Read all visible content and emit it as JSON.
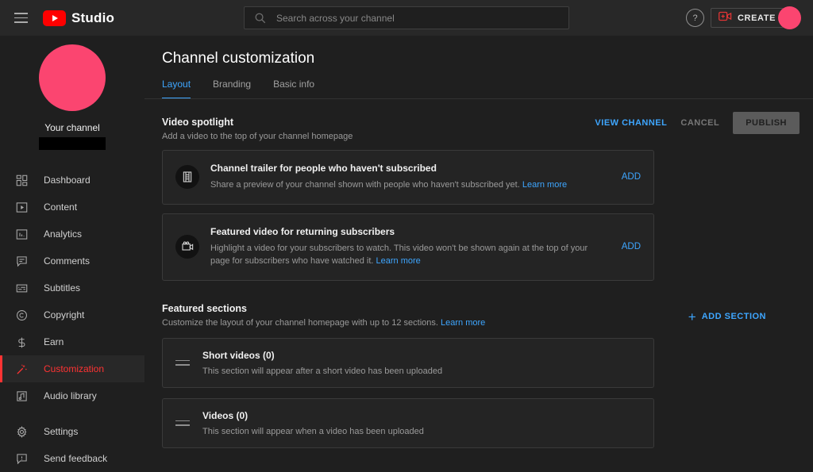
{
  "topbar": {
    "menu_icon": "hamburger-icon",
    "logo_text": "Studio",
    "search": {
      "placeholder": "Search across your channel",
      "value": "",
      "icon": "search-icon"
    },
    "help_icon": "?",
    "create_label": "CREATE",
    "create_icon": "video-camera-plus-icon",
    "avatar": "account-avatar"
  },
  "sidebar": {
    "channel": {
      "name": "Your channel",
      "handle_redacted": ""
    },
    "items": [
      {
        "label": "Dashboard",
        "icon": "dashboard-grid-icon",
        "active": false
      },
      {
        "label": "Content",
        "icon": "content-play-box-icon",
        "active": false
      },
      {
        "label": "Analytics",
        "icon": "analytics-bar-chart-icon",
        "active": false
      },
      {
        "label": "Comments",
        "icon": "comments-bubble-icon",
        "active": false
      },
      {
        "label": "Subtitles",
        "icon": "subtitles-cc-icon",
        "active": false
      },
      {
        "label": "Copyright",
        "icon": "copyright-circle-icon",
        "active": false
      },
      {
        "label": "Earn",
        "icon": "earn-dollar-icon",
        "active": false
      },
      {
        "label": "Customization",
        "icon": "magic-wand-icon",
        "active": true
      },
      {
        "label": "Audio library",
        "icon": "audio-note-icon",
        "active": false
      }
    ],
    "footer_items": [
      {
        "label": "Settings",
        "icon": "gear-icon"
      },
      {
        "label": "Send feedback",
        "icon": "feedback-icon"
      }
    ]
  },
  "main": {
    "title": "Channel customization",
    "tabs": [
      {
        "label": "Layout",
        "active": true
      },
      {
        "label": "Branding",
        "active": false
      },
      {
        "label": "Basic info",
        "active": false
      }
    ],
    "actions": {
      "view_channel": "VIEW CHANNEL",
      "cancel": "CANCEL",
      "publish": "PUBLISH"
    },
    "video_spotlight": {
      "title": "Video spotlight",
      "subtitle": "Add a video to the top of your channel homepage",
      "cards": [
        {
          "icon": "film-strip-icon",
          "title": "Channel trailer for people who haven't subscribed",
          "desc": "Share a preview of your channel shown with people who haven't subscribed yet.",
          "learn_more": "Learn more",
          "action": "ADD"
        },
        {
          "icon": "movie-camera-icon",
          "title": "Featured video for returning subscribers",
          "desc": "Highlight a video for your subscribers to watch. This video won't be shown again at the top of your page for subscribers who have watched it.",
          "learn_more": "Learn more",
          "action": "ADD"
        }
      ]
    },
    "featured_sections": {
      "title": "Featured sections",
      "subtitle": "Customize the layout of your channel homepage with up to 12 sections.",
      "learn_more": "Learn more",
      "add_button": "ADD SECTION",
      "rows": [
        {
          "title": "Short videos (0)",
          "desc": "This section will appear after a short video has been uploaded",
          "handle": "drag-handle-icon"
        },
        {
          "title": "Videos (0)",
          "desc": "This section will appear when a video has been uploaded",
          "handle": "drag-handle-icon"
        }
      ]
    }
  },
  "colors": {
    "accent_blue": "#3ea6ff",
    "accent_red": "#ff3333",
    "brand_red": "#ff0000",
    "avatar_pink": "#fb4570",
    "page_bg": "#1f1f1f",
    "card_bg": "#242424"
  }
}
